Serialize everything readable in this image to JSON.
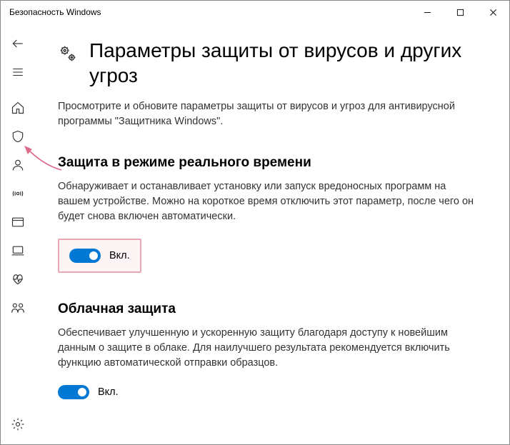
{
  "window": {
    "title": "Безопасность Windows"
  },
  "page": {
    "title": "Параметры защиты от вирусов и других угроз",
    "description": "Просмотрите и обновите параметры защиты от вирусов и угроз для антивирусной программы \"Защитника Windows\"."
  },
  "sections": {
    "realtime": {
      "title": "Защита в режиме реального времени",
      "description": "Обнаруживает и останавливает установку или запуск вредоносных программ на вашем устройстве. Можно на короткое время отключить этот параметр, после чего он будет снова включен автоматически.",
      "toggle_label": "Вкл.",
      "toggle_on": true
    },
    "cloud": {
      "title": "Облачная защита",
      "description": "Обеспечивает улучшенную и ускоренную защиту благодаря доступу к новейшим данным о защите в облаке. Для наилучшего результата рекомендуется включить функцию автоматической отправки образцов.",
      "toggle_label": "Вкл.",
      "toggle_on": true
    }
  },
  "colors": {
    "accent": "#0078d4",
    "annotation": "#e06a8a",
    "highlight_border": "#e9a6b4"
  }
}
